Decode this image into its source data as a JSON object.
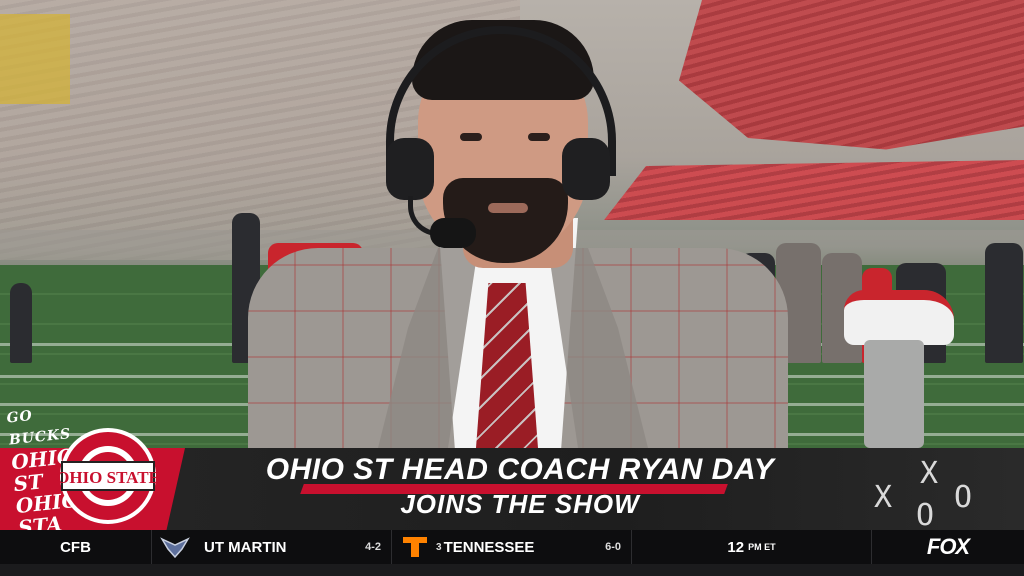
{
  "graphic": {
    "headline_line1": "OHIO ST HEAD COACH RYAN DAY",
    "headline_line2": "JOINS THE SHOW",
    "logo_text": "OHIO STATE",
    "go_bucks_text": [
      "GO",
      "BUCKS",
      "OHIO",
      "ST",
      "OHIO",
      "STA"
    ],
    "xo_marks": [
      "X",
      "O",
      "X",
      "O"
    ],
    "brand_red": "#c8102e"
  },
  "ticker": {
    "league": "CFB",
    "away_team": {
      "name": "UT MARTIN",
      "record": "4-2",
      "logo_icon": "ut-martin-skyhawk-icon"
    },
    "home_team": {
      "rank": "3",
      "name": "TENNESSEE",
      "record": "6-0",
      "logo_icon": "tennessee-t-icon",
      "color": "#ff8200"
    },
    "time": "12",
    "time_suffix": "PM ET",
    "network": "FOX"
  }
}
